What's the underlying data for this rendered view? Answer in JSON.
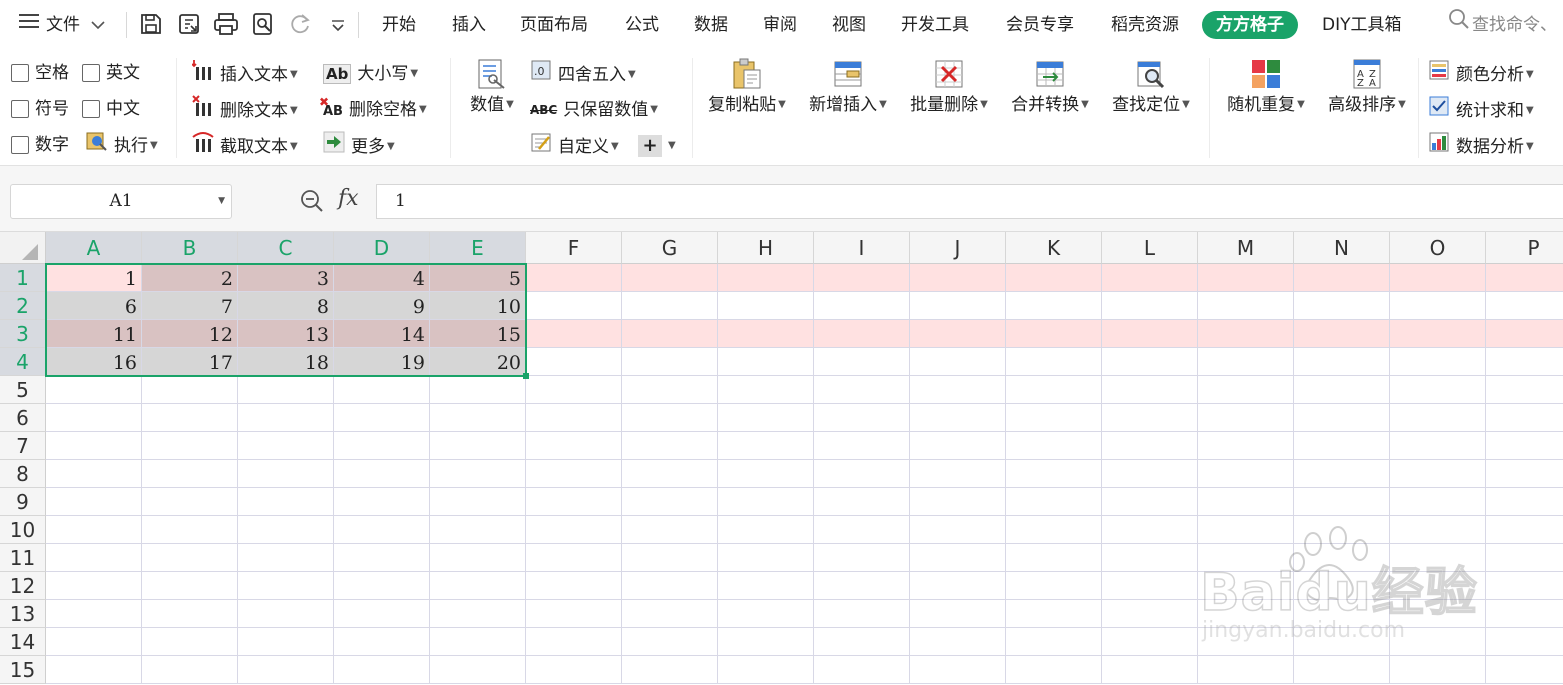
{
  "menubar": {
    "hamburger_icon": "hamburger-icon",
    "file_label": "文件",
    "quick_icons": [
      "save-icon",
      "export-icon",
      "print-icon",
      "print-preview-icon",
      "redo-icon",
      "more-icon"
    ],
    "tabs": [
      {
        "label": "开始"
      },
      {
        "label": "插入"
      },
      {
        "label": "页面布局"
      },
      {
        "label": "公式"
      },
      {
        "label": "数据"
      },
      {
        "label": "审阅"
      },
      {
        "label": "视图"
      },
      {
        "label": "开发工具"
      },
      {
        "label": "会员专享"
      },
      {
        "label": "稻壳资源"
      },
      {
        "label": "方方格子",
        "active": true
      },
      {
        "label": "DIY工具箱"
      }
    ],
    "search_placeholder": "查找命令、"
  },
  "ribbon": {
    "checkboxes": [
      {
        "label": "空格"
      },
      {
        "label": "英文"
      },
      {
        "label": "符号"
      },
      {
        "label": "中文"
      },
      {
        "label": "数字"
      }
    ],
    "execute_label": "执行",
    "text_ops": [
      {
        "label": "插入文本"
      },
      {
        "label": "删除文本"
      },
      {
        "label": "截取文本"
      }
    ],
    "case_ops": [
      {
        "label": "大小写"
      },
      {
        "label": "删除空格"
      },
      {
        "label": "更多"
      }
    ],
    "numeric_label": "数值",
    "number_ops": [
      {
        "label": "四舍五入"
      },
      {
        "label": "只保留数值"
      },
      {
        "label": "自定义"
      }
    ],
    "big_buttons": [
      {
        "label": "复制粘贴"
      },
      {
        "label": "新增插入"
      },
      {
        "label": "批量删除"
      },
      {
        "label": "合并转换"
      },
      {
        "label": "查找定位"
      },
      {
        "label": "随机重复"
      },
      {
        "label": "高级排序"
      }
    ],
    "analysis_ops": [
      {
        "label": "颜色分析"
      },
      {
        "label": "统计求和"
      },
      {
        "label": "数据分析"
      }
    ]
  },
  "formula_bar": {
    "name_box": "A1",
    "fx_label": "fx",
    "formula": "1"
  },
  "sheet": {
    "columns": [
      "A",
      "B",
      "C",
      "D",
      "E",
      "F",
      "G",
      "H",
      "I",
      "J",
      "K",
      "L",
      "M",
      "N",
      "O",
      "P"
    ],
    "selected_columns": [
      "A",
      "B",
      "C",
      "D",
      "E"
    ],
    "rows": [
      "1",
      "2",
      "3",
      "4",
      "5",
      "6",
      "7",
      "8",
      "9",
      "10",
      "11",
      "12",
      "13",
      "14",
      "15"
    ],
    "selected_rows": [
      "1",
      "2",
      "3",
      "4"
    ],
    "data": [
      [
        "1",
        "2",
        "3",
        "4",
        "5"
      ],
      [
        "6",
        "7",
        "8",
        "9",
        "10"
      ],
      [
        "11",
        "12",
        "13",
        "14",
        "15"
      ],
      [
        "16",
        "17",
        "18",
        "19",
        "20"
      ]
    ],
    "colors": {
      "accent": "#1aa369",
      "row_highlight": "#ffe1e1",
      "band_odd": "#d9c2c2",
      "band_even": "#d6d6d6",
      "active_cell": "#ffe1e1"
    }
  },
  "watermark": {
    "brand": "Baidu经验",
    "url": "jingyan.baidu.com"
  }
}
